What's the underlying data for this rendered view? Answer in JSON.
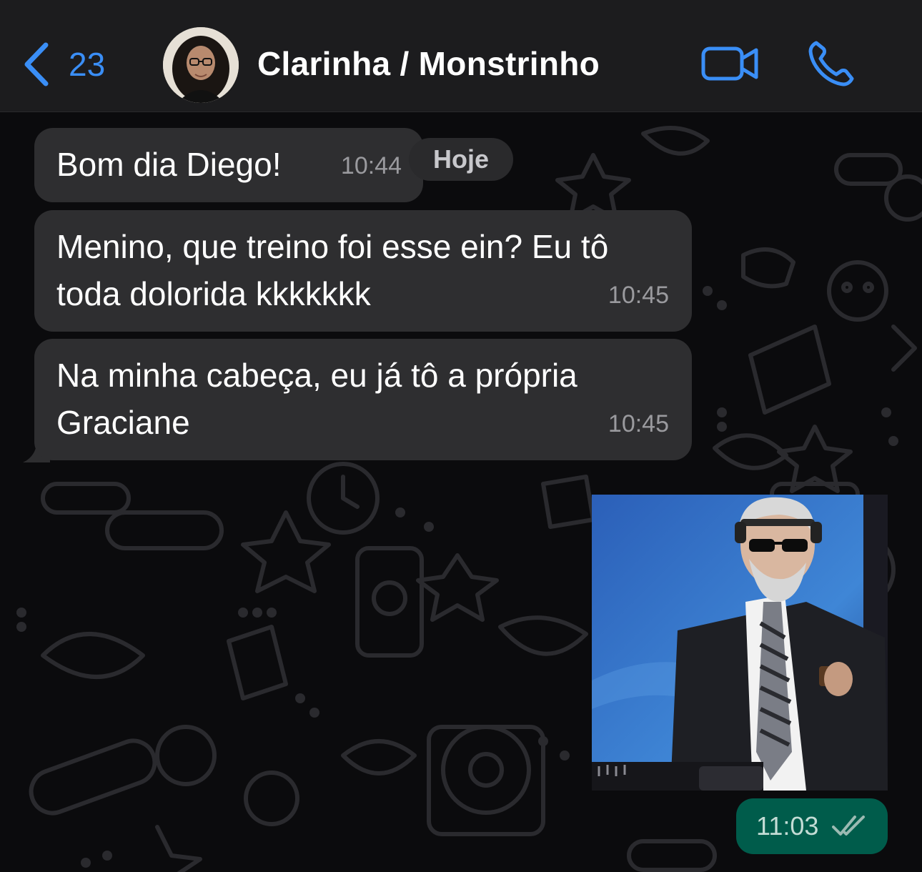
{
  "header": {
    "back_count": "23",
    "contact_name": "Clarinha / Monstrinho",
    "accent_color": "#3a8ef6",
    "icons": [
      "chevron-left-icon",
      "video-camera-icon",
      "phone-icon"
    ]
  },
  "date_separator": "Hoje",
  "messages": [
    {
      "direction": "incoming",
      "text": "Bom dia Diego!",
      "time": "10:44"
    },
    {
      "direction": "incoming",
      "text": "Menino, que treino foi esse ein? Eu tô toda dolorida kkkkkkk",
      "time": "10:45"
    },
    {
      "direction": "incoming",
      "text": "Na minha cabeça, eu já tô a própria Graciane",
      "time": "10:45"
    },
    {
      "direction": "outgoing",
      "type": "image",
      "time": "11:03",
      "status": "read-double-check"
    }
  ],
  "colors": {
    "incoming_bubble": "#2e2e30",
    "outgoing_bubble": "#005c4b",
    "header_bg": "#1c1c1e",
    "chat_bg": "#0b0b0d"
  }
}
